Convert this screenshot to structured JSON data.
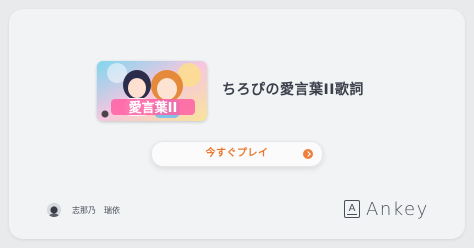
{
  "song": {
    "title": "ちろぴの愛言葉II歌詞",
    "thumbnail_text": "愛言葉II"
  },
  "actions": {
    "play_label": "今すぐプレイ",
    "play_icon": "chevron-right-icon"
  },
  "author": {
    "name": "志那乃　瑞依",
    "avatar": "avatar"
  },
  "brand": {
    "logo_mark": "A",
    "name": "Ankey"
  },
  "colors": {
    "accent": "#e9782f",
    "background": "#e9eaec",
    "card": "#f2f3f5"
  }
}
